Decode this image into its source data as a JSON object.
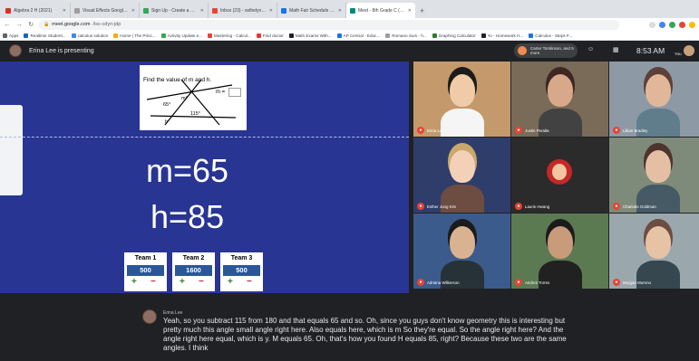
{
  "browser": {
    "tabs": [
      {
        "label": "Algebra 2 H (2021)",
        "active": false,
        "color": "#d93025"
      },
      {
        "label": "Visual Effects Google Meet",
        "active": false,
        "color": "#9e9e9e"
      },
      {
        "label": "Sign Up - Create a Free Acco",
        "active": false,
        "color": "#34a853"
      },
      {
        "label": "Inbox (23) - ssthelyngblmill",
        "active": false,
        "color": "#ea4335"
      },
      {
        "label": "Math Fair Schedule - Google",
        "active": false,
        "color": "#1a73e8"
      },
      {
        "label": "Meet - 8th Grade C (Afte",
        "active": true,
        "color": "#00897b"
      }
    ],
    "new_tab_label": "+",
    "url_host": "meet.google.com",
    "url_path": "/isc-cdyn-jdp",
    "bookmarks": [
      {
        "label": "Apps",
        "color": "#5f6368"
      },
      {
        "label": "Realtime Student...",
        "color": "#1565c0"
      },
      {
        "label": "calculus solution",
        "color": "#4285f4"
      },
      {
        "label": "Home | The Princ...",
        "color": "#f9ab00"
      },
      {
        "label": "Activity Update e...",
        "color": "#34a853"
      },
      {
        "label": "Mastering - Calcul...",
        "color": "#ea4335"
      },
      {
        "label": "Find doctor",
        "color": "#e53935"
      },
      {
        "label": "Math Exams With...",
        "color": "#202124"
      },
      {
        "label": "AP Central - Educ...",
        "color": "#1a73e8"
      },
      {
        "label": "Romano Sum - h...",
        "color": "#9e9e9e"
      },
      {
        "label": "Graphing Calculator",
        "color": "#2e7d32"
      },
      {
        "label": "Yo - Homework H...",
        "color": "#202124"
      },
      {
        "label": "Calculus - Steps F...",
        "color": "#1a73e8"
      }
    ]
  },
  "meet": {
    "presenting_label": "Erina Lee is presenting",
    "pill_text": "Carter Tomlinson, and 5 more",
    "time": "8:53 AM",
    "you_label": "You"
  },
  "slide": {
    "problem_title": "Find the value of m and h.",
    "m_equals": "m =",
    "angle_labels": [
      "65°",
      "m°",
      "h",
      "115°"
    ],
    "m_result": "m=65",
    "h_result": "h=85",
    "plus_label": "+",
    "minus_label": "−",
    "teams": [
      {
        "name": "Team 1",
        "score": "500"
      },
      {
        "name": "Team 2",
        "score": "1600"
      },
      {
        "name": "Team 3",
        "score": "500"
      }
    ]
  },
  "participants": [
    {
      "name": "Erina Lee",
      "bg": "#c49a6c",
      "skin": "#f0cba8",
      "hair": "#1b1b1b",
      "shirt": "#f5f5f5"
    },
    {
      "name": "Justin Peralta",
      "bg": "#7a6a58",
      "skin": "#d7a98a",
      "hair": "#3e2723",
      "shirt": "#424242"
    },
    {
      "name": "Lillian Bradley",
      "bg": "#8d9aa6",
      "skin": "#e0b899",
      "hair": "#5d4037",
      "shirt": "#607d8b"
    },
    {
      "name": "Esther Jung Kim",
      "bg": "#2f3d6b",
      "skin": "#f3d0b8",
      "hair": "#c9a86a",
      "shirt": "#6d4c41"
    },
    {
      "name": "Laurie Hwang",
      "bg": "#2b2b2b",
      "skin": "#f1c7a1",
      "hair": "#1b1b1b",
      "shirt": "#c62828"
    },
    {
      "name": "Charlotte Goldman",
      "bg": "#7f8b7a",
      "skin": "#e4bfa4",
      "hair": "#4e342e",
      "shirt": "#455a64"
    },
    {
      "name": "Adriana Wilkerson",
      "bg": "#3b5b8c",
      "skin": "#d9b391",
      "hair": "#1b1b1b",
      "shirt": "#263238"
    },
    {
      "name": "Andres Torres",
      "bg": "#5c7a52",
      "skin": "#c89b7b",
      "hair": "#1b1b1b",
      "shirt": "#212121"
    },
    {
      "name": "Morgan Moreno",
      "bg": "#9aa7ad",
      "skin": "#e7c3a5",
      "hair": "#6d4c41",
      "shirt": "#37474f"
    }
  ],
  "captions": {
    "speaker": "Erina Lee",
    "text": "Yeah, so you subtract 115 from 180 and that equals 65 and so. Oh, since you guys don't know geometry this is interesting but pretty much this angle small angle right here. Also equals here, which is m So they're equal. So the angle right here? And the angle right here equal, which is y. M equals 65. Oh, that's how you found H equals 85, right? Because these two are the same angles. I think"
  }
}
